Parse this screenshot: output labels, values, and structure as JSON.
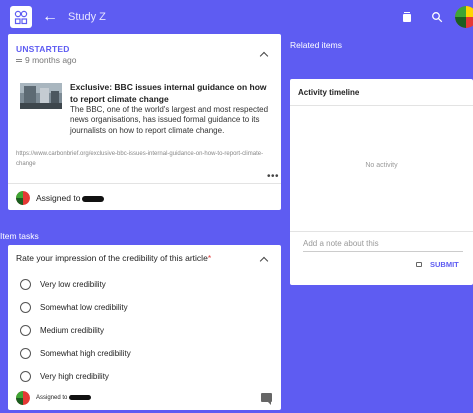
{
  "header": {
    "title": "Study Z",
    "back_icon": "arrow-left-icon",
    "logo_icon": "app-logo-icon",
    "delete_icon": "trash-icon",
    "search_icon": "search-icon"
  },
  "item": {
    "status": "UNSTARTED",
    "time": "9 months ago",
    "article": {
      "title": "Exclusive: BBC issues internal guidance on how to report climate change",
      "description": "The BBC, one of the world's largest and most respected news organisations, has issued formal guidance to its journalists on how to report climate change.",
      "url": "https://www.carbonbrief.org/exclusive-bbc-issues-internal-guidance-on-how-to-report-climate-change"
    },
    "more_label": "•••",
    "assigned_label": "Assigned to"
  },
  "tasks": {
    "section_title": "Item tasks",
    "question": "Rate your impression of the credibility of this article",
    "required_mark": "*",
    "options": [
      "Very low credibility",
      "Somewhat low credibility",
      "Medium credibility",
      "Somewhat high credibility",
      "Very high credibility"
    ],
    "assigned_label": "Assigned to"
  },
  "related": {
    "title": "Related items"
  },
  "activity": {
    "title": "Activity timeline",
    "empty_text": "No activity",
    "note_placeholder": "Add a note about this",
    "submit_label": "SUBMIT"
  },
  "colors": {
    "accent": "#5e5cf2",
    "required": "#e23b3b"
  }
}
